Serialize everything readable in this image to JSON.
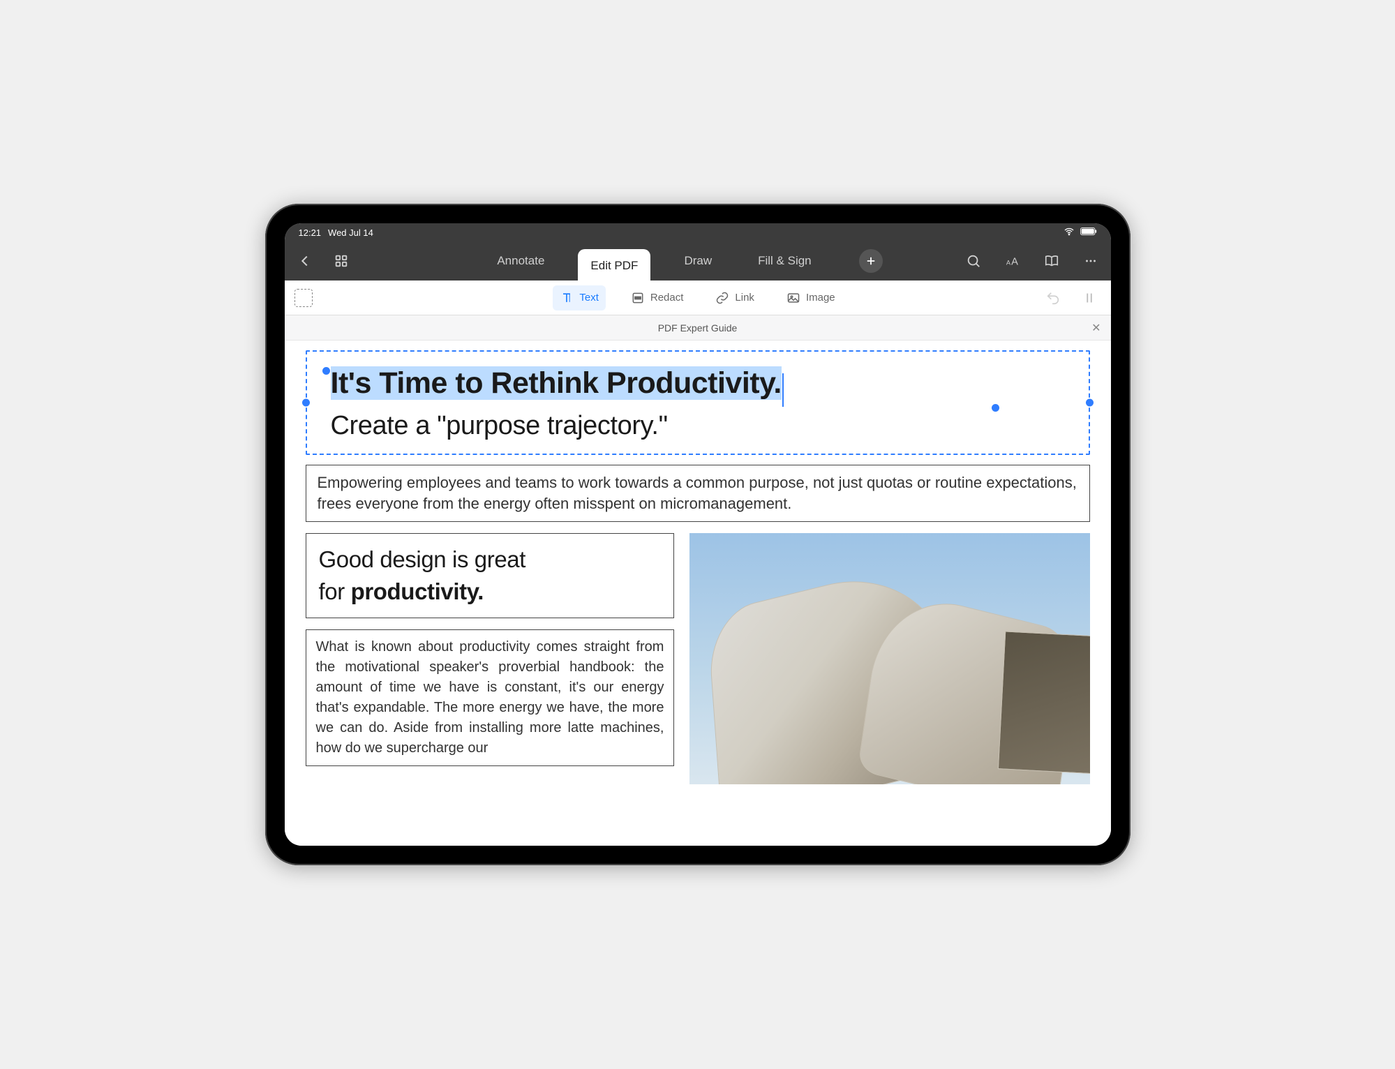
{
  "status": {
    "time": "12:21",
    "date": "Wed Jul 14"
  },
  "topbar": {
    "tabs": [
      {
        "label": "Annotate"
      },
      {
        "label": "Edit PDF"
      },
      {
        "label": "Draw"
      },
      {
        "label": "Fill & Sign"
      }
    ]
  },
  "tools": {
    "text": "Text",
    "redact": "Redact",
    "link": "Link",
    "image": "Image"
  },
  "doc": {
    "title": "PDF Expert Guide",
    "headline": "It's Time to Rethink Productivity.",
    "subhead": "Create a \"purpose trajectory.\"",
    "intro": "Empowering employees and teams to work towards a common purpose, not just quotas or routine expectations, frees everyone from the energy often misspent on micromanagement.",
    "design_line1": "Good design is great",
    "design_line2_pre": "for ",
    "design_line2_bold": "productivity.",
    "body": "What is known about productivity comes straight from the motivational speaker's proverbial handbook: the amount of time we have is constant, it's our energy that's expandable. The more energy we have, the more we can do. Aside from installing more latte machines, how do we supercharge our"
  }
}
